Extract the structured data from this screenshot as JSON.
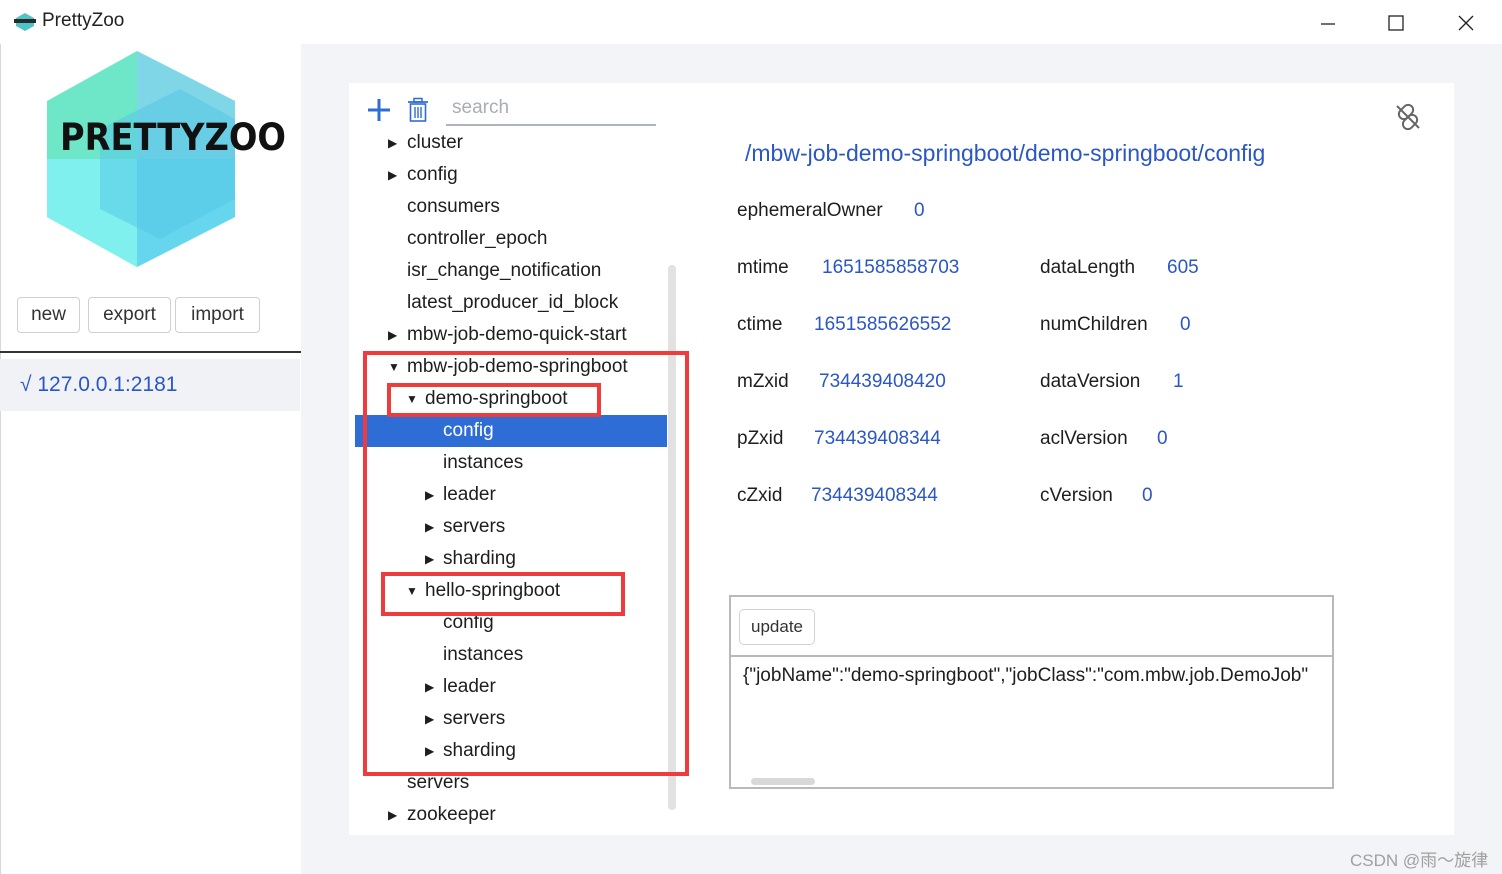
{
  "window": {
    "title": "PrettyZoo"
  },
  "logo": {
    "text": "PRETTYZOO"
  },
  "sidebar": {
    "buttons": [
      "new",
      "export",
      "import"
    ],
    "servers": [
      {
        "label": "√ 127.0.0.1:2181"
      }
    ]
  },
  "toolbar": {
    "search_placeholder": "search",
    "icons": [
      "plus-icon",
      "trash-icon"
    ]
  },
  "tree": {
    "nodes": [
      {
        "label": "cluster",
        "depth": 0,
        "arrow": "collapsed"
      },
      {
        "label": "config",
        "depth": 0,
        "arrow": "collapsed"
      },
      {
        "label": "consumers",
        "depth": 0,
        "arrow": "none"
      },
      {
        "label": "controller_epoch",
        "depth": 0,
        "arrow": "none"
      },
      {
        "label": "isr_change_notification",
        "depth": 0,
        "arrow": "none"
      },
      {
        "label": "latest_producer_id_block",
        "depth": 0,
        "arrow": "none"
      },
      {
        "label": "mbw-job-demo-quick-start",
        "depth": 0,
        "arrow": "collapsed"
      },
      {
        "label": "mbw-job-demo-springboot",
        "depth": 0,
        "arrow": "expanded"
      },
      {
        "label": "demo-springboot",
        "depth": 1,
        "arrow": "expanded"
      },
      {
        "label": "config",
        "depth": 2,
        "arrow": "none",
        "selected": true
      },
      {
        "label": "instances",
        "depth": 2,
        "arrow": "none"
      },
      {
        "label": "leader",
        "depth": 2,
        "arrow": "collapsed"
      },
      {
        "label": "servers",
        "depth": 2,
        "arrow": "collapsed"
      },
      {
        "label": "sharding",
        "depth": 2,
        "arrow": "collapsed"
      },
      {
        "label": "hello-springboot",
        "depth": 1,
        "arrow": "expanded"
      },
      {
        "label": "config",
        "depth": 2,
        "arrow": "none"
      },
      {
        "label": "instances",
        "depth": 2,
        "arrow": "none"
      },
      {
        "label": "leader",
        "depth": 2,
        "arrow": "collapsed"
      },
      {
        "label": "servers",
        "depth": 2,
        "arrow": "collapsed"
      },
      {
        "label": "sharding",
        "depth": 2,
        "arrow": "collapsed"
      },
      {
        "label": "servers",
        "depth": 0,
        "arrow": "none"
      },
      {
        "label": "zookeeper",
        "depth": 0,
        "arrow": "collapsed"
      }
    ]
  },
  "node": {
    "path": "/mbw-job-demo-springboot/demo-springboot/config",
    "ephemeralOwner": {
      "label": "ephemeralOwner",
      "value": "0"
    },
    "mtime": {
      "label": "mtime",
      "value": "1651585858703"
    },
    "ctime": {
      "label": "ctime",
      "value": "1651585626552"
    },
    "mZxid": {
      "label": "mZxid",
      "value": "734439408420"
    },
    "pZxid": {
      "label": "pZxid",
      "value": "734439408344"
    },
    "cZxid": {
      "label": "cZxid",
      "value": "734439408344"
    },
    "dataLength": {
      "label": "dataLength",
      "value": "605"
    },
    "numChildren": {
      "label": "numChildren",
      "value": "0"
    },
    "dataVersion": {
      "label": "dataVersion",
      "value": "1"
    },
    "aclVersion": {
      "label": "aclVersion",
      "value": "0"
    },
    "cVersion": {
      "label": "cVersion",
      "value": "0"
    }
  },
  "editor": {
    "update_label": "update",
    "content": "{\"jobName\":\"demo-springboot\",\"jobClass\":\"com.mbw.job.DemoJob\""
  },
  "watermark": "CSDN @雨～旋律",
  "colors": {
    "accent": "#2b57c4",
    "selected": "#2e6dd6",
    "highlight_box": "#ee3b3b"
  }
}
